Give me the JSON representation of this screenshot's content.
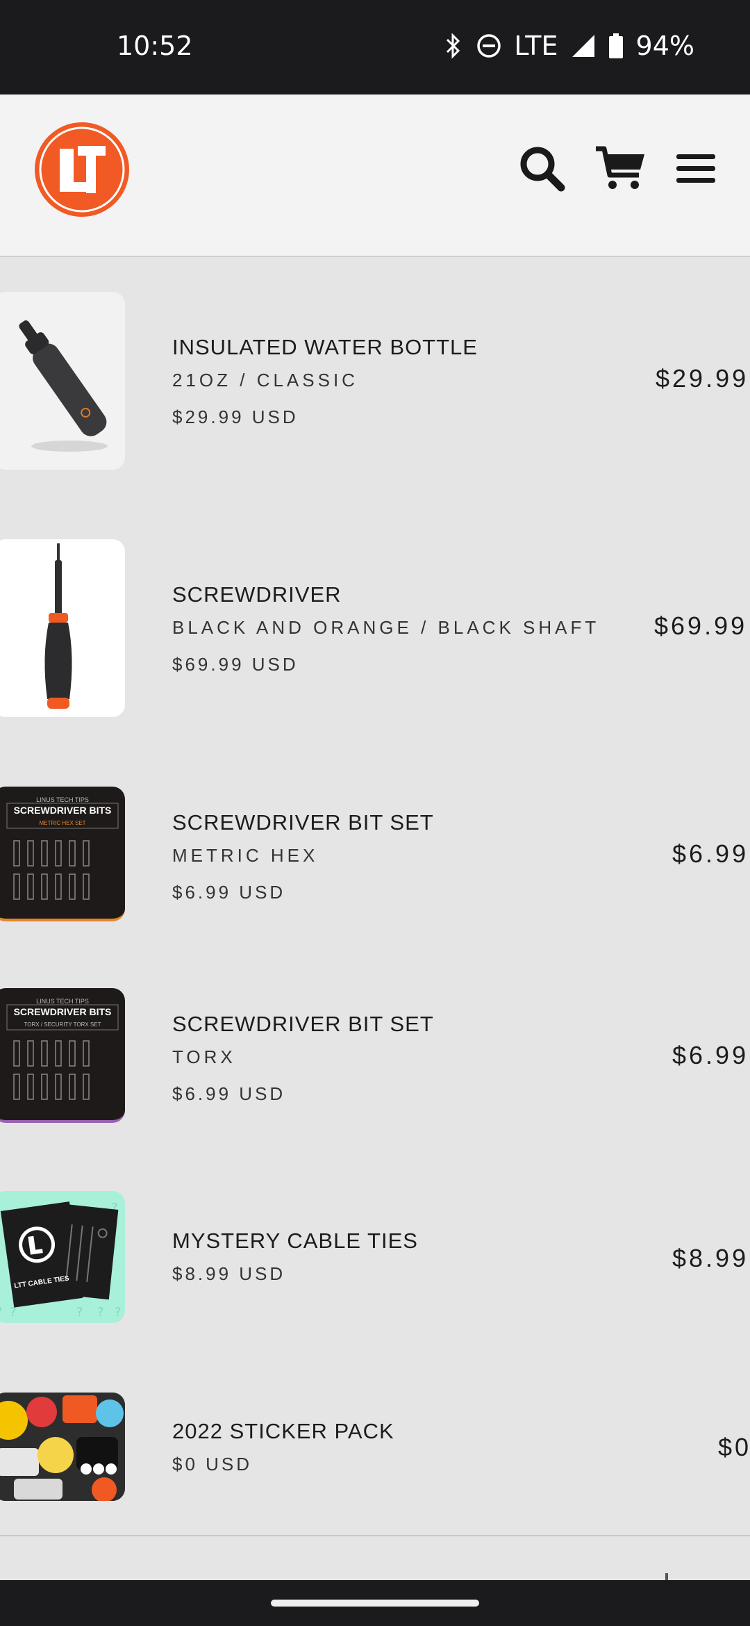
{
  "status": {
    "time": "10:52",
    "network": "LTE",
    "battery": "94%"
  },
  "header": {
    "logo_text": "LTT",
    "brand_color": "#f15a24",
    "icons": [
      "search-icon",
      "cart-icon",
      "menu-icon"
    ]
  },
  "cart_items": [
    {
      "title": "INSULATED WATER BOTTLE",
      "variant": "21OZ / CLASSIC",
      "unit_price": "$29.99 USD",
      "line_total": "$29.99"
    },
    {
      "title": "SCREWDRIVER",
      "variant": "BLACK AND ORANGE / BLACK SHAFT",
      "unit_price": "$69.99 USD",
      "line_total": "$69.99"
    },
    {
      "title": "SCREWDRIVER BIT SET",
      "variant": "METRIC HEX",
      "unit_price": "$6.99 USD",
      "line_total": "$6.99"
    },
    {
      "title": "SCREWDRIVER BIT SET",
      "variant": "TORX",
      "unit_price": "$6.99 USD",
      "line_total": "$6.99"
    },
    {
      "title": "MYSTERY CABLE TIES",
      "unit_price": "$8.99 USD",
      "line_total": "$8.99"
    },
    {
      "title": "2022 STICKER PACK",
      "unit_price": "$0 USD",
      "line_total": "$0"
    }
  ],
  "thumb_text": {
    "bit_brand": "LINUS TECH TIPS",
    "bit_title": "SCREWDRIVER BITS",
    "bit_metric_sub": "METRIC HEX SET",
    "bit_torx_sub": "TORX / SECURITY TORX SET",
    "cable_ties": "LTT CABLE TIES"
  }
}
